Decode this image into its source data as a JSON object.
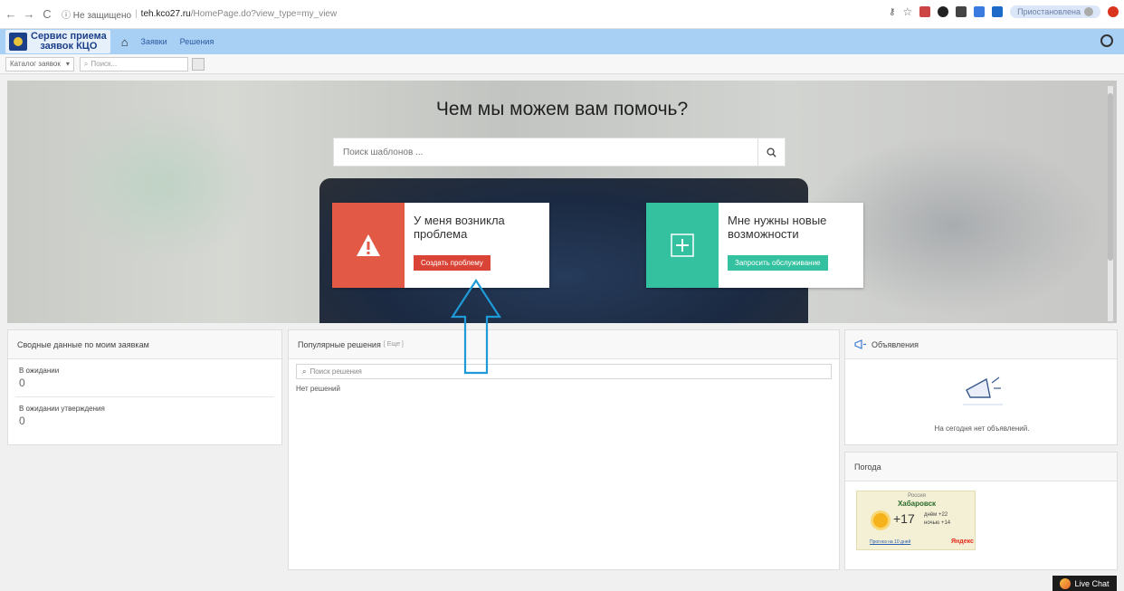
{
  "browser": {
    "back": "←",
    "forward": "→",
    "reload": "C",
    "security": "ⓘ Не защищено",
    "host": "teh.kco27.ru",
    "path": "/HomePage.do?view_type=my_view",
    "profile": "Приостановлена"
  },
  "header": {
    "logo_line1": "Сервис приема",
    "logo_line2": "заявок КЦО",
    "nav": [
      "Заявки",
      "Решения"
    ]
  },
  "toolbar": {
    "catalog": "Каталог заявок",
    "search_placeholder": "Поиск..."
  },
  "hero": {
    "title": "Чем мы можем вам помочь?",
    "search_placeholder": "Поиск шаблонов ...",
    "cards": [
      {
        "title": "У меня возникла проблема",
        "button": "Создать проблему",
        "color": "#e25a45"
      },
      {
        "title": "Мне нужны новые возможности",
        "button": "Запросить обслуживание",
        "color": "#34c1a0"
      }
    ]
  },
  "summary": {
    "title": "Сводные данные по моим заявкам",
    "items": [
      {
        "label": "В ожидании",
        "value": "0"
      },
      {
        "label": "В ожидании утверждения",
        "value": "0"
      }
    ]
  },
  "popular": {
    "title": "Популярные решения",
    "more": "[ Еще ]",
    "search_placeholder": "Поиск решения",
    "empty": "Нет решений"
  },
  "announcements": {
    "title": "Объявления",
    "empty": "На сегодня нет объявлений."
  },
  "weather": {
    "title": "Погода",
    "country": "Россия",
    "city": "Хабаровск",
    "temp": "+17",
    "day": "днём +22",
    "night": "ночью +14",
    "link": "Прогноз на 10 дней",
    "brand": "Яндекс"
  },
  "live_chat": "Live Chat"
}
